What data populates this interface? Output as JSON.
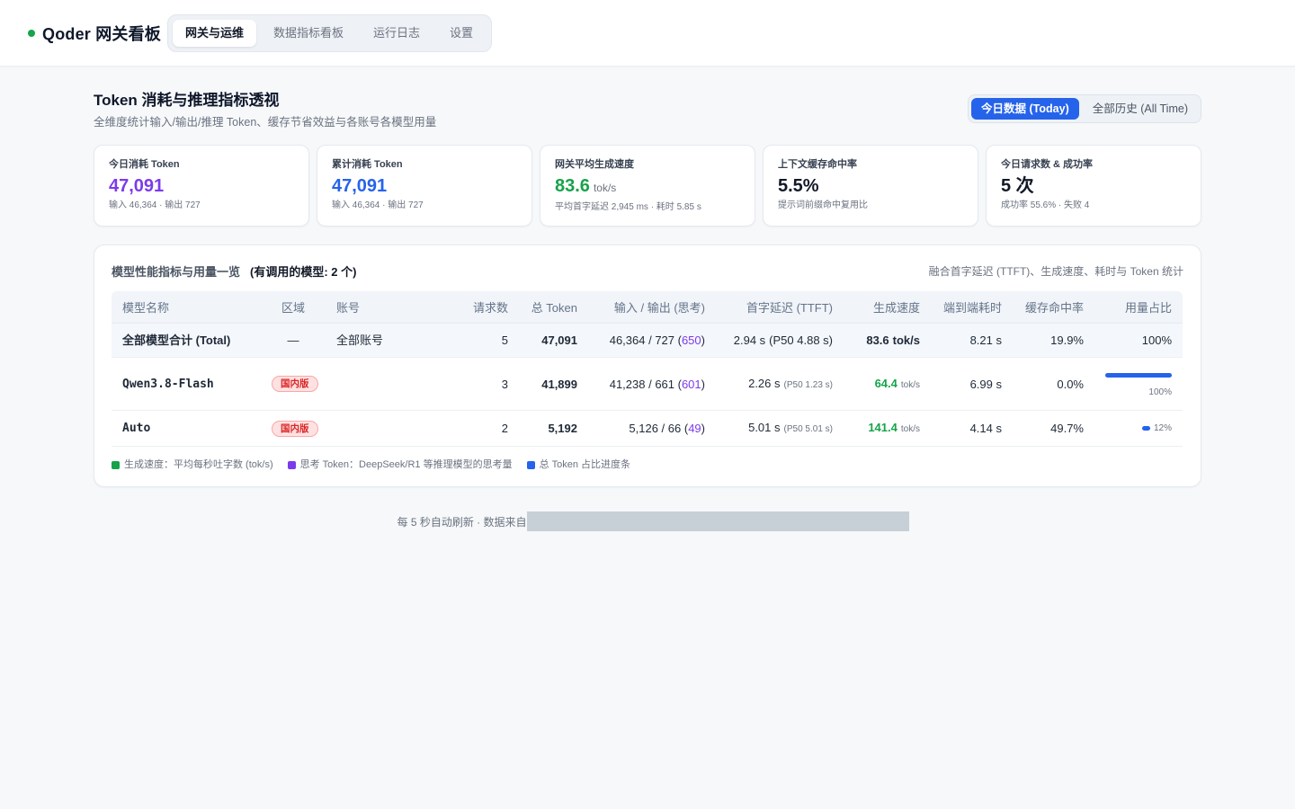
{
  "colors": {
    "blue": "#2563eb",
    "purple": "#7c3aed",
    "green": "#16a34a",
    "badge_red": "#dc2626"
  },
  "header": {
    "title": "Qoder 网关看板",
    "status_color": "#16a34a",
    "tabs": [
      {
        "label": "网关与运维",
        "active": true
      },
      {
        "label": "数据指标看板",
        "active": false
      },
      {
        "label": "运行日志",
        "active": false
      },
      {
        "label": "设置",
        "active": false
      }
    ]
  },
  "section": {
    "title": "Token 消耗与推理指标透视",
    "subtitle": "全维度统计输入/输出/推理 Token、缓存节省效益与各账号各模型用量",
    "range_toggle": [
      {
        "label": "今日数据 (Today)",
        "active": true
      },
      {
        "label": "全部历史 (All Time)",
        "active": false
      }
    ]
  },
  "stats": [
    {
      "label": "今日消耗 Token",
      "value": "47,091",
      "sub": "输入 46,364 · 输出 727",
      "color": "#7c3aed"
    },
    {
      "label": "累计消耗 Token",
      "value": "47,091",
      "sub": "输入 46,364 · 输出 727",
      "color": "#2563eb"
    },
    {
      "label": "网关平均生成速度",
      "value": "83.6",
      "unit": "tok/s",
      "sub": "平均首字延迟 2,945 ms · 耗时 5.85 s",
      "color": "#16a34a"
    },
    {
      "label": "上下文缓存命中率",
      "value": "5.5%",
      "sub": "提示词前缀命中复用比",
      "color": "#111827"
    },
    {
      "label": "今日请求数 & 成功率",
      "value": "5 次",
      "sub": "成功率 55.6% · 失败 4",
      "color": "#111827"
    }
  ],
  "models_panel": {
    "title": "模型性能指标与用量一览",
    "count_text": "(有调用的模型: 2 个)",
    "note": "融合首字延迟 (TTFT)、生成速度、耗时与 Token 统计",
    "columns": [
      "模型名称",
      "区域",
      "账号",
      "请求数",
      "总 Token",
      "输入 / 输出 (思考)",
      "首字延迟 (TTFT)",
      "生成速度",
      "端到端耗时",
      "缓存命中率",
      "用量占比"
    ],
    "total": {
      "model": "全部模型合计 (Total)",
      "region": "—",
      "account": "全部账号",
      "requests": "5",
      "total_token": "47,091",
      "io_main": "46,364 / 727 (",
      "think": "650",
      "io_close": ")",
      "ttft": "2.94 s",
      "ttft_p50": "(P50 4.88 s)",
      "speed": "83.6",
      "speed_unit": "tok/s",
      "e2e": "8.21 s",
      "cache": "19.9%",
      "usage": "100%"
    },
    "rows": [
      {
        "model": "Qwen3.8-Flash",
        "region": "国内版",
        "requests": "3",
        "total_token": "41,899",
        "io_main": "41,238 / 661 (",
        "think": "601",
        "io_close": ")",
        "ttft": "2.26 s",
        "ttft_p50": "(P50 1.23 s)",
        "speed": "64.4",
        "speed_unit": "tok/s",
        "e2e": "6.99 s",
        "cache": "0.0%",
        "usage": "100%",
        "usage_fill": 1.0
      },
      {
        "model": "Auto",
        "region": "国内版",
        "requests": "2",
        "total_token": "5,192",
        "io_main": "5,126 / 66 (",
        "think": "49",
        "io_close": ")",
        "ttft": "5.01 s",
        "ttft_p50": "(P50 5.01 s)",
        "speed": "141.4",
        "speed_unit": "tok/s",
        "e2e": "4.14 s",
        "cache": "49.7%",
        "usage": "12%",
        "usage_fill": 0.12
      }
    ]
  },
  "legend": [
    {
      "label": "生成速度：平均每秒吐字数 (tok/s)",
      "color": "#16a34a"
    },
    {
      "label": "思考 Token：DeepSeek/R1 等推理模型的思考量",
      "color": "#7c3aed"
    },
    {
      "label": "总 Token 占比进度条",
      "color": "#2563eb"
    }
  ],
  "footer": {
    "text": "每 5 秒自动刷新 · 数据来自"
  }
}
